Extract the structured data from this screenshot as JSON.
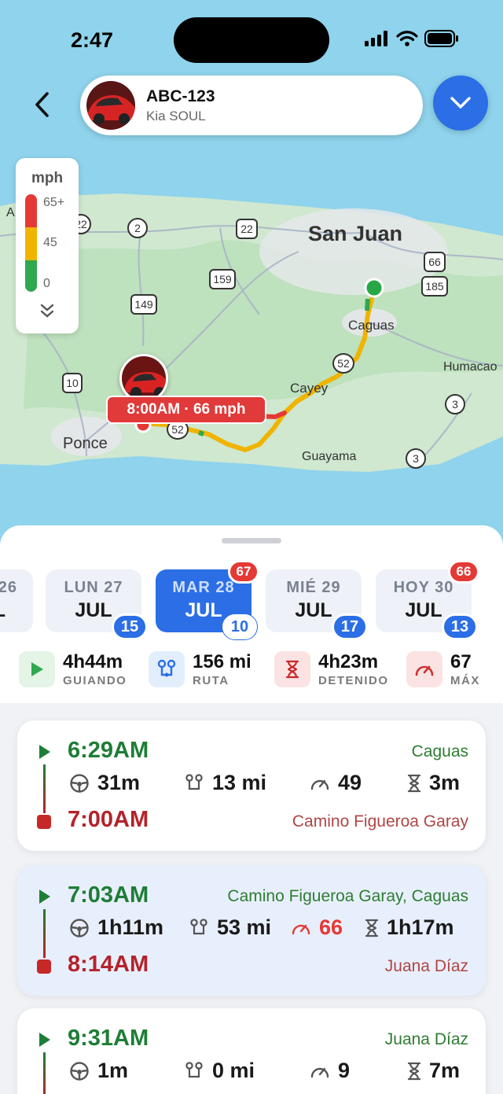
{
  "status": {
    "time": "2:47"
  },
  "vehicle": {
    "plate": "ABC-123",
    "model": "Kia SOUL"
  },
  "legend": {
    "unit": "mph",
    "high": "65+",
    "mid": "45",
    "low": "0"
  },
  "map": {
    "places": [
      "San Juan",
      "Caguas",
      "Cayey",
      "Humacao",
      "Ponce",
      "Guayama",
      "A"
    ],
    "shields": [
      "22",
      "2",
      "22",
      "159",
      "149",
      "10",
      "52",
      "52",
      "66",
      "185",
      "3",
      "3",
      "52"
    ],
    "speed_callout": "8:00AM · 66 mph",
    "colors": {
      "route_fast": "#e53935",
      "route_mid": "#f0b400",
      "route_slow": "#2fa84f"
    }
  },
  "days": [
    {
      "name": "26",
      "month": "L",
      "trips": ""
    },
    {
      "name": "LUN 27",
      "month": "JUL",
      "trips": "15"
    },
    {
      "name": "MAR 28",
      "month": "JUL",
      "trips": "10",
      "alerts": "67",
      "selected": true
    },
    {
      "name": "MIÉ 29",
      "month": "JUL",
      "trips": "17"
    },
    {
      "name": "HOY 30",
      "month": "JUL",
      "trips": "13",
      "alerts": "66"
    }
  ],
  "stats": [
    {
      "value": "4h44m",
      "label": "GUIANDO",
      "icon": "play-icon"
    },
    {
      "value": "156 mi",
      "label": "RUTA",
      "icon": "route-icon"
    },
    {
      "value": "4h23m",
      "label": "DETENIDO",
      "icon": "hourglass-icon"
    },
    {
      "value": "67",
      "label": "MÁX",
      "icon": "speedometer-icon"
    }
  ],
  "trips": [
    {
      "start_time": "6:29AM",
      "start_place": "Caguas",
      "end_time": "7:00AM",
      "end_place": "Camino Figueroa Garay",
      "duration": "31m",
      "distance": "13 mi",
      "max_speed": "49",
      "idle": "3m",
      "speeding": false
    },
    {
      "start_time": "7:03AM",
      "start_place": "Camino Figueroa Garay, Caguas",
      "end_time": "8:14AM",
      "end_place": "Juana Díaz",
      "duration": "1h11m",
      "distance": "53 mi",
      "max_speed": "66",
      "idle": "1h17m",
      "speeding": true
    },
    {
      "start_time": "9:31AM",
      "start_place": "Juana Díaz",
      "end_time": "",
      "end_place": "",
      "duration": "1m",
      "distance": "0 mi",
      "max_speed": "9",
      "idle": "7m",
      "speeding": false
    }
  ]
}
